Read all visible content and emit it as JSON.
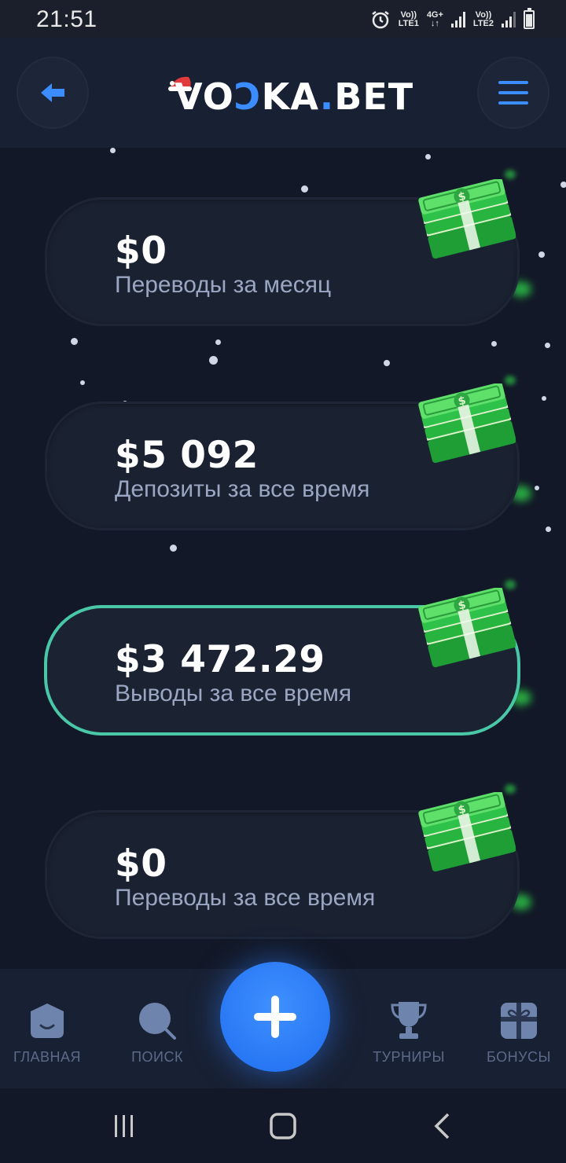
{
  "status_bar": {
    "time": "21:51",
    "sim1": {
      "top": "Vo))",
      "bottom": "LTE1"
    },
    "network": {
      "top": "4G+",
      "bottom": "↓↑"
    },
    "sim2": {
      "top": "Vo))",
      "bottom": "LTE2"
    }
  },
  "header": {
    "logo_main": "VO",
    "logo_accent": "Ↄ",
    "logo_rest": "KA",
    "logo_dot": ".",
    "logo_end": "BET",
    "back_icon": "arrow-left-icon",
    "menu_icon": "hamburger-menu-icon"
  },
  "stats": [
    {
      "value": "$0",
      "label": "Переводы за месяц",
      "active": false
    },
    {
      "value": "$5 092",
      "label": "Депозиты за все время",
      "active": false
    },
    {
      "value": "$3 472.29",
      "label": "Выводы за все время",
      "active": true
    },
    {
      "value": "$0",
      "label": "Переводы за все время",
      "active": false
    }
  ],
  "bottom_nav": {
    "home": "ГЛАВНАЯ",
    "search": "ПОИСК",
    "tournaments": "ТУРНИРЫ",
    "bonuses": "БОНУСЫ"
  },
  "colors": {
    "background": "#121827",
    "card": "#1a2131",
    "active_border": "#49c7a6",
    "accent_blue": "#3a8cff",
    "label": "#9aa6c2",
    "nav_label": "#5c6a88"
  }
}
